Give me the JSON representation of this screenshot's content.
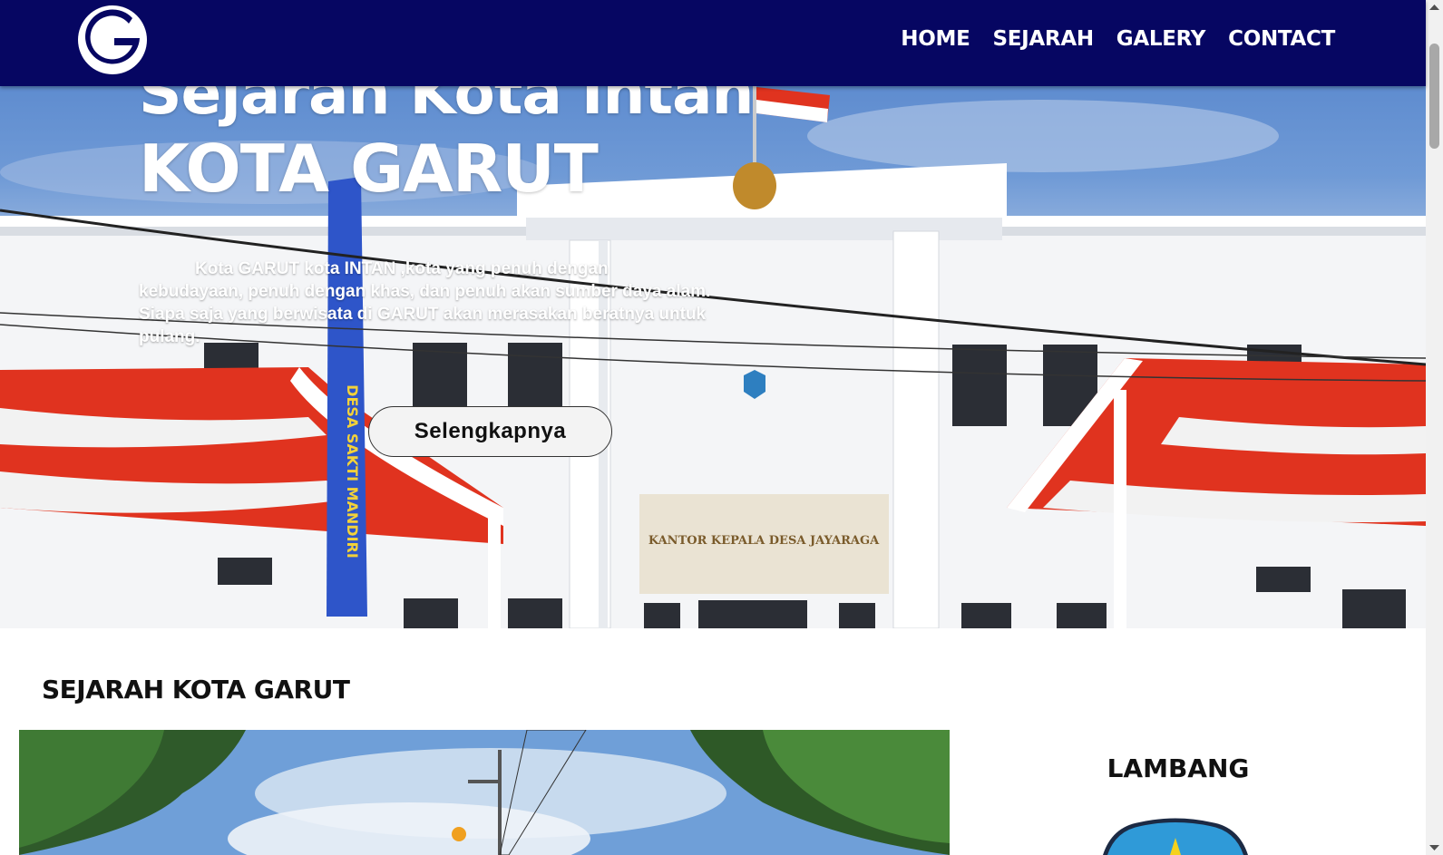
{
  "nav": {
    "logo_letter": "G",
    "links": [
      "HOME",
      "SEJARAH",
      "GALERY",
      "CONTACT"
    ]
  },
  "hero": {
    "title_line1": "Sejarah Kota Intan",
    "title_line2": "KOTA GARUT",
    "description": "Kota GARUT kota INTAN ,kota yang penuh dengan kebudayaan, penuh dengan khas, dan penuh akan sumber daya alam. Siapa saja yang berwisata di GARUT akan merasakan beratnya untuk pulang.",
    "button_label": "Selengkapnya",
    "banner_text": "DESA SAKTI MANDIRI",
    "building_sign": "KANTOR KEPALA DESA JAYARAGA"
  },
  "main": {
    "section_title": "SEJARAH KOTA GARUT",
    "sidebar_title": "LAMBANG"
  },
  "colors": {
    "navbar": "#060662",
    "flag_red": "#e0331f",
    "banner_blue": "#2e55c9"
  },
  "icons": [
    "garut-logo-icon",
    "scroll-up-icon",
    "scroll-down-icon",
    "emblem-icon"
  ]
}
